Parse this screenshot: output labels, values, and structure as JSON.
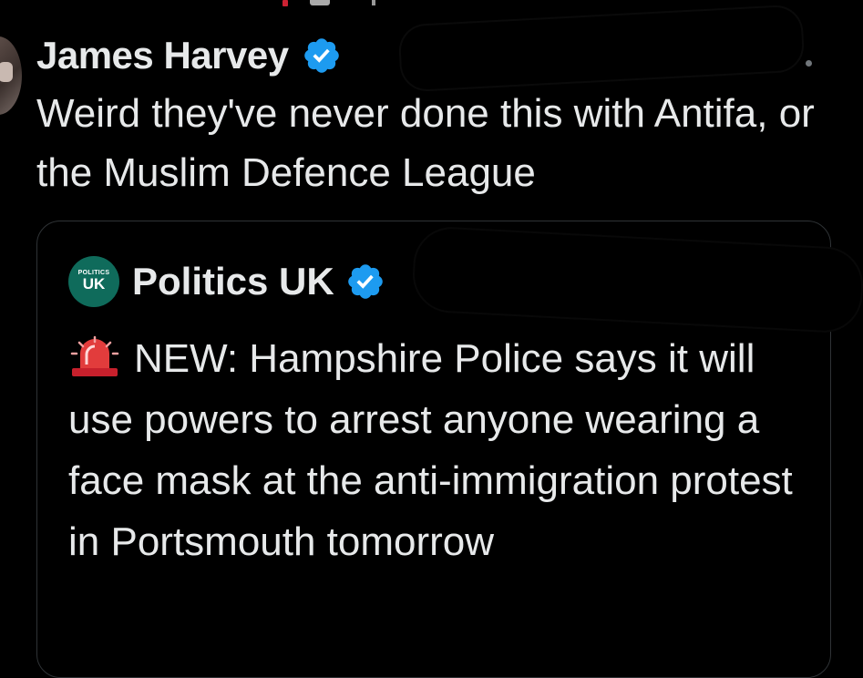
{
  "tweet": {
    "author_name": "James Harvey",
    "text": "Weird they've never done this with Antifa, or the Muslim Defence League"
  },
  "quoted_tweet": {
    "author_name": "Politics UK",
    "avatar_text_small": "POLITICS",
    "avatar_text_large": "UK",
    "text": "NEW: Hampshire Police says it will use powers to arrest anyone wearing a face mask at the anti-immigration protest in Portsmouth tomorrow",
    "leading_emoji": "police-car-light-icon"
  },
  "colors": {
    "background": "#000000",
    "text": "#e7e9ea",
    "verified": "#1d9bf0",
    "card_border": "#2f3336",
    "brand_avatar": "#0f6b5b"
  }
}
